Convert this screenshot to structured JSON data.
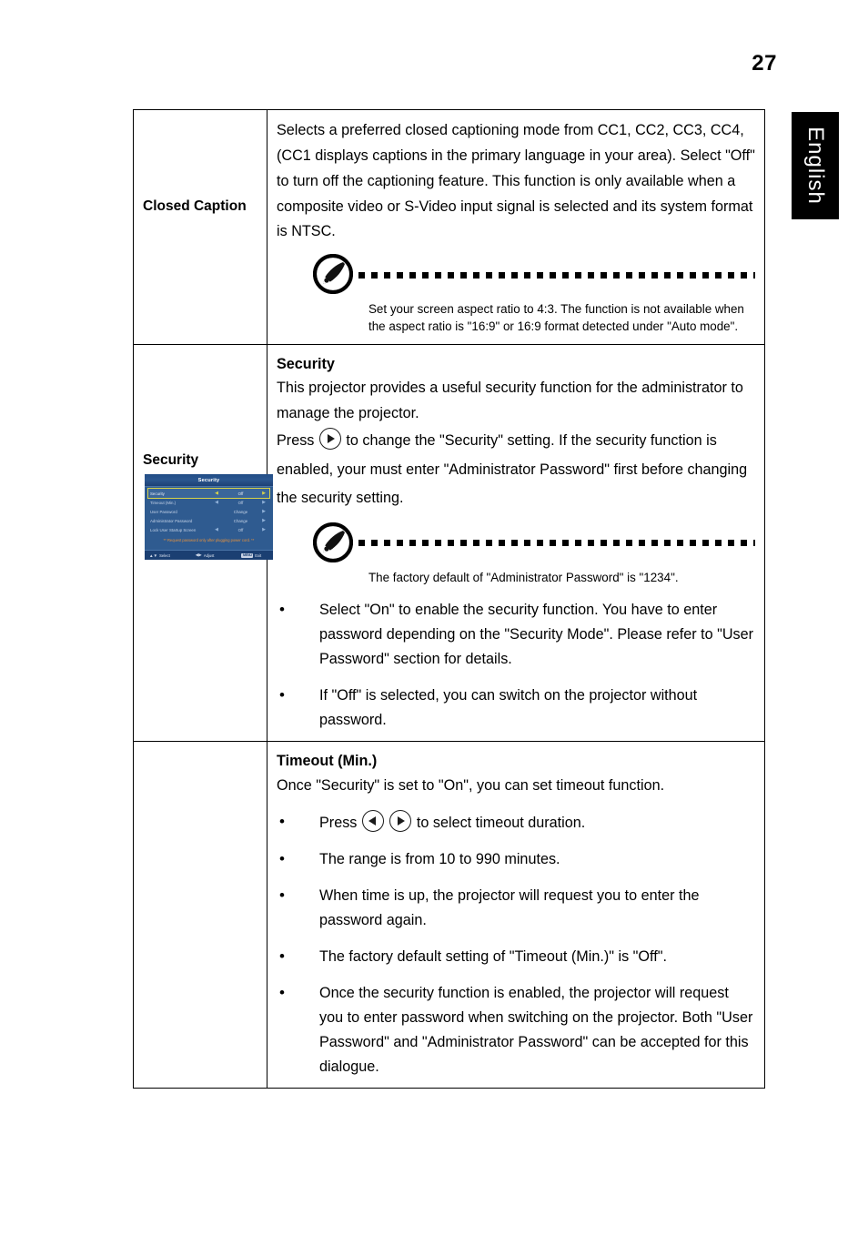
{
  "page": {
    "number": "27",
    "side_tab_label": "English"
  },
  "table": {
    "rows": [
      {
        "label": "Closed Caption",
        "body_paragraph": "Selects a preferred closed captioning mode from CC1, CC2, CC3, CC4, (CC1 displays captions in the primary language in your area). Select \"Off\" to turn off the captioning feature. This function is only available when a composite video or S-Video input signal is selected and its system format is NTSC.",
        "note": "Set your screen aspect ratio to 4:3. The function is not available when the aspect ratio is \"16:9\" or 16:9 format detected under \"Auto mode\"."
      },
      {
        "label": "Security",
        "heading": "Security",
        "para1": "This projector provides a useful security function for the administrator to manage the projector.",
        "para2_before": "Press",
        "para2_after": "to change the \"Security\" setting. If the security function is enabled, your must enter \"Administrator Password\" first before changing the security setting.",
        "note": "The factory default of \"Administrator Password\" is \"1234\".",
        "bullets": [
          "Select \"On\" to enable the security function. You have to enter password depending on the \"Security Mode\". Please refer to \"User Password\" section for details.",
          "If \"Off\" is selected, you can switch on the projector without password."
        ]
      },
      {
        "label": "",
        "heading": "Timeout (Min.)",
        "para1": "Once \"Security\" is set to \"On\", you can set timeout function.",
        "bullet_press_before": "Press",
        "bullet_press_after": "to select timeout duration.",
        "bullets": [
          "The range is from 10 to 990 minutes.",
          "When time is up, the projector will request you to enter the password again.",
          "The factory default setting of \"Timeout (Min.)\" is \"Off\".",
          "Once the security function is enabled, the projector will request you to enter password when switching on the projector. Both \"User Password\" and \"Administrator Password\" can be accepted for this dialogue."
        ]
      }
    ]
  },
  "osd": {
    "title": "Security",
    "rows": [
      {
        "name": "Security",
        "left_arrow": "◀",
        "value": "Off",
        "right_arrow": "▶",
        "selected": true
      },
      {
        "name": "Timeout (Min.)",
        "left_arrow": "◀",
        "value": "Off",
        "right_arrow": "▶",
        "selected": false
      },
      {
        "name": "User Password",
        "left_arrow": "",
        "value": "Change",
        "right_arrow": "▶",
        "selected": false
      },
      {
        "name": "Administrator Password",
        "left_arrow": "",
        "value": "Change",
        "right_arrow": "▶",
        "selected": false
      },
      {
        "name": "Lock User Startup Screen",
        "left_arrow": "◀",
        "value": "Off",
        "right_arrow": "▶",
        "selected": false
      }
    ],
    "warning": "** Request password only after plugging power cord. **",
    "footer": {
      "select_glyph": "▲▼",
      "select_label": "Select",
      "adjust_glyph": "◀▶",
      "adjust_label": "Adjust",
      "exit_key": "MENU",
      "exit_label": "Exit"
    },
    "colors": {
      "background": "#2f5b90",
      "title_bar": "#214c85",
      "highlight_outline": "#d8d24a",
      "warning_text": "#e8923c",
      "footer_bar": "#1b3f72"
    }
  }
}
